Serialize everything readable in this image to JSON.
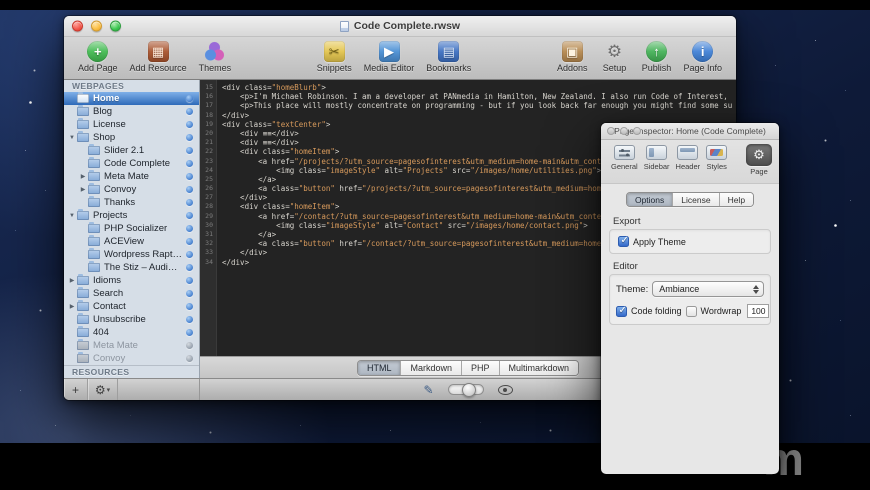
{
  "colors": {
    "accent_blue": "#2f66b8",
    "editor_bg": "#232323",
    "editor_text": "#d9d6cf",
    "editor_string": "#d79a5c",
    "sidebar_bg": "#d6dee7",
    "dot_blue": "#4d86d2"
  },
  "icons": {
    "plus": "+",
    "gear": "⚙",
    "dropdown_arrow": "▾",
    "pencil": "✎"
  },
  "desktop": {
    "watermark": "m"
  },
  "main_window": {
    "title": "Code Complete.rwsw",
    "toolbar": {
      "left": [
        {
          "label": "Add Page",
          "icon": {
            "name": "add-page-icon",
            "shape": "circle",
            "bg": "#3fb94e",
            "glyph": "+",
            "glyph_color": "#ffffff"
          }
        },
        {
          "label": "Add Resource",
          "icon": {
            "name": "add-resource-icon",
            "shape": "square",
            "bg": "#a8522c",
            "glyph": "▦",
            "glyph_color": "#ffe9d8"
          }
        },
        {
          "label": "Themes",
          "icon": {
            "name": "themes-icon",
            "shape": "trio"
          }
        }
      ],
      "center": [
        {
          "label": "Snippets",
          "icon": {
            "name": "snippets-icon",
            "shape": "square",
            "bg": "#e3c44c",
            "glyph": "✂",
            "glyph_color": "#6b5a14"
          }
        },
        {
          "label": "Media Editor",
          "icon": {
            "name": "media-editor-icon",
            "shape": "square",
            "bg": "#4a8fd4",
            "glyph": "▶",
            "glyph_color": "#ffffff"
          }
        },
        {
          "label": "Bookmarks",
          "icon": {
            "name": "bookmarks-icon",
            "shape": "square",
            "bg": "#3c6fc2",
            "glyph": "▤",
            "glyph_color": "#dce8fa"
          }
        }
      ],
      "right": [
        {
          "label": "Addons",
          "icon": {
            "name": "addons-icon",
            "shape": "square",
            "bg": "#b5884e",
            "glyph": "▣",
            "glyph_color": "#fdf3e0"
          }
        },
        {
          "label": "Setup",
          "icon": {
            "name": "setup-icon",
            "shape": "plain",
            "glyph": "⚙",
            "glyph_color": "#6f6f6f"
          }
        },
        {
          "label": "Publish",
          "icon": {
            "name": "publish-icon",
            "shape": "circle",
            "bg": "#41b054",
            "glyph": "↑",
            "glyph_color": "#ffffff"
          }
        },
        {
          "label": "Page Info",
          "icon": {
            "name": "page-info-icon",
            "shape": "circle",
            "bg": "#3d7fd6",
            "glyph": "i",
            "glyph_color": "#ffffff"
          }
        }
      ]
    },
    "sidebar": {
      "webpages_header": "WEBPAGES",
      "resources_header": "RESOURCES",
      "items": [
        {
          "label": "Home",
          "indent": 0,
          "selected": true,
          "dot": "blue"
        },
        {
          "label": "Blog",
          "indent": 0,
          "dot": "blue"
        },
        {
          "label": "License",
          "indent": 0,
          "dot": "blue"
        },
        {
          "label": "Shop",
          "indent": 0,
          "expander": "open",
          "dot": "blue"
        },
        {
          "label": "Slider 2.1",
          "indent": 1,
          "dot": "blue"
        },
        {
          "label": "Code Complete",
          "indent": 1,
          "dot": "blue"
        },
        {
          "label": "Meta Mate",
          "indent": 1,
          "expander": "closed",
          "dot": "blue"
        },
        {
          "label": "Convoy",
          "indent": 1,
          "expander": "closed",
          "dot": "blue"
        },
        {
          "label": "Thanks",
          "indent": 1,
          "dot": "blue"
        },
        {
          "label": "Projects",
          "indent": 0,
          "expander": "open",
          "dot": "blue"
        },
        {
          "label": "PHP Socializer",
          "indent": 1,
          "dot": "blue"
        },
        {
          "label": "ACEView",
          "indent": 1,
          "dot": "blue"
        },
        {
          "label": "Wordpress Raptor...",
          "indent": 1,
          "dot": "blue"
        },
        {
          "label": "The Stiz – Audio f...",
          "indent": 1,
          "dot": "blue"
        },
        {
          "label": "Idioms",
          "indent": 0,
          "expander": "closed",
          "dot": "blue"
        },
        {
          "label": "Search",
          "indent": 0,
          "dot": "blue"
        },
        {
          "label": "Contact",
          "indent": 0,
          "expander": "closed",
          "dot": "blue"
        },
        {
          "label": "Unsubscribe",
          "indent": 0,
          "dot": "blue"
        },
        {
          "label": "404",
          "indent": 0,
          "dot": "blue"
        },
        {
          "label": "Meta Mate",
          "indent": 0,
          "dimmed": true,
          "dot": "dim"
        },
        {
          "label": "Convoy",
          "indent": 0,
          "dimmed": true,
          "dot": "dim"
        }
      ]
    },
    "editor": {
      "first_line_number": 15,
      "code_lines": [
        "<div class=\"homeBlurb\">",
        "    <p>I'm Michael Robinson. I am a developer at PANmedia in Hamilton, New Zealand. I also run Code of Interest,",
        "    <p>This place will mostly concentrate on programming - but if you look back far enough you might find some su",
        "</div>",
        "<div class=\"textCenter\">",
        "    <div ≡≡</div>",
        "    <div ≡≡</div>",
        "    <div class=\"homeItem\">",
        "        <a href=\"/projects/?utm_source=pagesofinterest&utm_medium=home-main&utm_conte",
        "            <img class=\"imageStyle\" alt=\"Projects\" src=\"/images/home/utilities.png\">",
        "        </a>",
        "        <a class=\"button\" href=\"/projects/?utm_source=pagesofinterest&utm_medium=home-",
        "    </div>",
        "    <div class=\"homeItem\">",
        "        <a href=\"/contact/?utm_source=pagesofinterest&utm_medium=home-main&utm_content",
        "            <img class=\"imageStyle\" alt=\"Contact\" src=\"/images/home/contact.png\">",
        "        </a>",
        "        <a class=\"button\" href=\"/contact/?utm_source=pagesofinterest&utm_medium=home-",
        "    </div>",
        "</div>"
      ],
      "tabs": [
        "HTML",
        "Markdown",
        "PHP",
        "Multimarkdown"
      ],
      "active_tab": "HTML"
    }
  },
  "inspector": {
    "title": "Page Inspector: Home (Code Complete)",
    "toolbar": [
      {
        "label": "General",
        "name": "general"
      },
      {
        "label": "Sidebar",
        "name": "sidebar"
      },
      {
        "label": "Header",
        "name": "header"
      },
      {
        "label": "Styles",
        "name": "styles"
      }
    ],
    "page_button": "Page",
    "tabs": [
      "Options",
      "License",
      "Help"
    ],
    "active_tab": "Options",
    "export_label": "Export",
    "apply_theme": {
      "label": "Apply Theme",
      "checked": true
    },
    "editor_label": "Editor",
    "theme": {
      "label": "Theme:",
      "value": "Ambiance"
    },
    "code_folding": {
      "label": "Code folding",
      "checked": true
    },
    "wordwrap": {
      "label": "Wordwrap",
      "checked": false,
      "value": "100"
    }
  }
}
